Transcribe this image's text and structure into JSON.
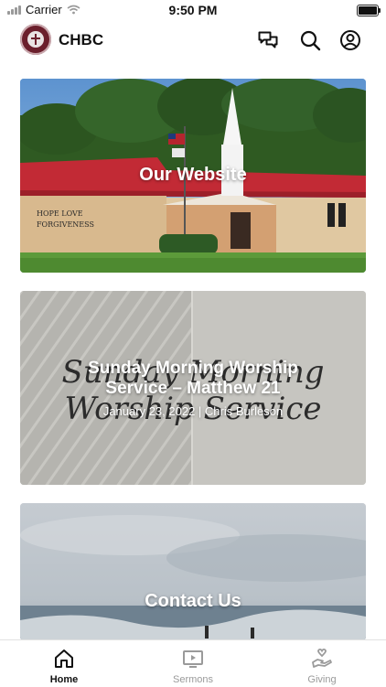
{
  "status_bar": {
    "carrier": "Carrier",
    "time": "9:50 PM"
  },
  "header": {
    "title": "CHBC",
    "icons": [
      "chat-icon",
      "search-icon",
      "account-icon"
    ]
  },
  "cards": {
    "website": {
      "label": "Our Website",
      "sign_text": "HOPE LOVE\nFORGIVENESS"
    },
    "sermon": {
      "label": "Sunday Morning Worship Service – Matthew 21",
      "date": "January 23, 2022 | Chris Burleson",
      "artwork_line1": "Sunday Morning",
      "artwork_line2": "Worship Service"
    },
    "contact": {
      "label": "Contact Us"
    }
  },
  "tab_bar": {
    "tabs": [
      {
        "label": "Home",
        "icon": "home-icon",
        "active": true
      },
      {
        "label": "Sermons",
        "icon": "play-icon",
        "active": false
      },
      {
        "label": "Giving",
        "icon": "giving-hand-icon",
        "active": false
      }
    ]
  },
  "colors": {
    "accent": "#111111",
    "inactive": "#9a9a9a",
    "brand": "#6b1f2c",
    "roof": "#c22a35"
  }
}
